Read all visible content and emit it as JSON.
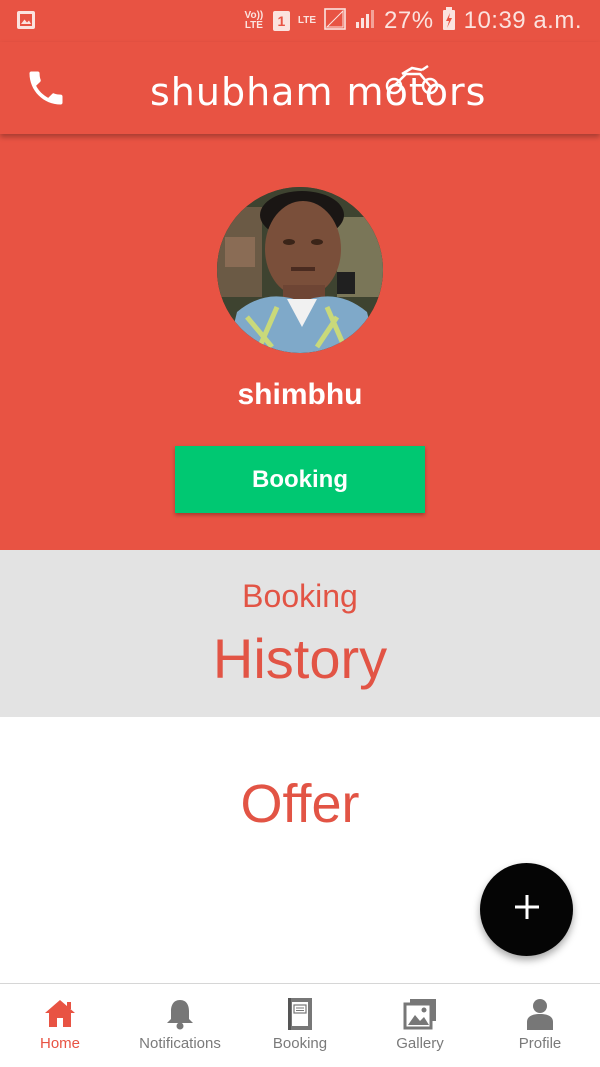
{
  "status_bar": {
    "volte": "Vo)) LTE",
    "sim": "1",
    "lte": "LTE",
    "battery": "27%",
    "time": "10:39 a.m."
  },
  "app_bar": {
    "brand": "shubham motors",
    "phone_icon": "phone-icon"
  },
  "profile": {
    "username": "shimbhu",
    "booking_button": "Booking"
  },
  "history": {
    "top": "Booking",
    "main": "History"
  },
  "offer": {
    "title": "Offer"
  },
  "fab": {
    "icon": "plus-icon"
  },
  "bottom_nav": {
    "items": [
      {
        "label": "Home",
        "icon": "home-icon",
        "active": true
      },
      {
        "label": "Notifications",
        "icon": "bell-icon",
        "active": false
      },
      {
        "label": "Booking",
        "icon": "book-icon",
        "active": false
      },
      {
        "label": "Gallery",
        "icon": "gallery-icon",
        "active": false
      },
      {
        "label": "Profile",
        "icon": "person-icon",
        "active": false
      }
    ]
  },
  "colors": {
    "primary": "#e85343",
    "accent_green": "#00c872",
    "history_bg": "#e3e3e3",
    "text_red": "#e25445",
    "fab": "#050505"
  }
}
